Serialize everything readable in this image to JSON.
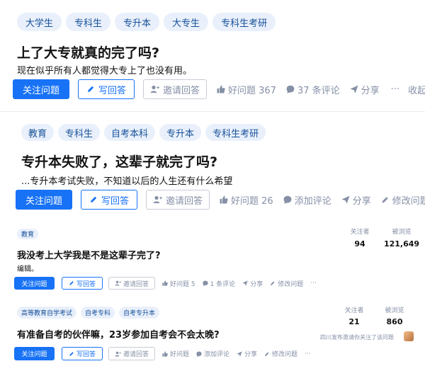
{
  "blocks": [
    {
      "tags": [
        "大学生",
        "专科生",
        "专升本",
        "大专生",
        "专科生考研"
      ],
      "title": "上了大专就真的完了吗?",
      "excerpt": "现在似乎所有人都觉得大专上了也没有用。",
      "follow_label": "关注问题",
      "answer_label": "写回答",
      "invite_label": "邀请回答",
      "good_label": "好问题 367",
      "comment_label": "37 条评论",
      "share_label": "分享",
      "more_label": "···",
      "collapse_label": "收起"
    },
    {
      "tags": [
        "教育",
        "专科生",
        "自考本科",
        "专升本",
        "专科生考研"
      ],
      "title": "专升本失败了，这辈子就完了吗?",
      "excerpt": "...专升本考试失败，不知道以后的人生还有什么希望",
      "follow_label": "关注问题",
      "answer_label": "写回答",
      "invite_label": "邀请回答",
      "good_label": "好问题 26",
      "comment_label": "添加评论",
      "share_label": "分享",
      "edit_label": "修改问题"
    },
    {
      "tags": [
        "教育"
      ],
      "title": "我没考上大学我是不是这辈子完了?",
      "excerpt": "编辑。",
      "follow_label": "关注问题",
      "answer_label": "写回答",
      "invite_label": "邀请回答",
      "good_label": "好问题 5",
      "comment_label": "1 条评论",
      "share_label": "分享",
      "edit_label": "修改问题",
      "more_label": "···",
      "followers_label": "关注者",
      "followers_value": "94",
      "views_label": "被浏览",
      "views_value": "121,649"
    },
    {
      "tags": [
        "高等教育自学考试",
        "自考专科",
        "自考专升本"
      ],
      "title": "有准备自考的伙伴嘛，23岁参加自考会不会太晚?",
      "follow_label": "关注问题",
      "answer_label": "写回答",
      "invite_label": "邀请回答",
      "good_label": "好问题",
      "comment_label": "添加评论",
      "share_label": "分享",
      "edit_label": "修改问题",
      "more_label": "···",
      "followers_label": "关注者",
      "followers_value": "21",
      "views_label": "被浏览",
      "views_value": "860",
      "invited_note": "四川发布邀请你关注了该问题"
    }
  ],
  "colors": {
    "primary": "#1772f6",
    "tag_bg": "#e9f0fb",
    "tag_text": "#175199",
    "muted": "#8590a6"
  }
}
